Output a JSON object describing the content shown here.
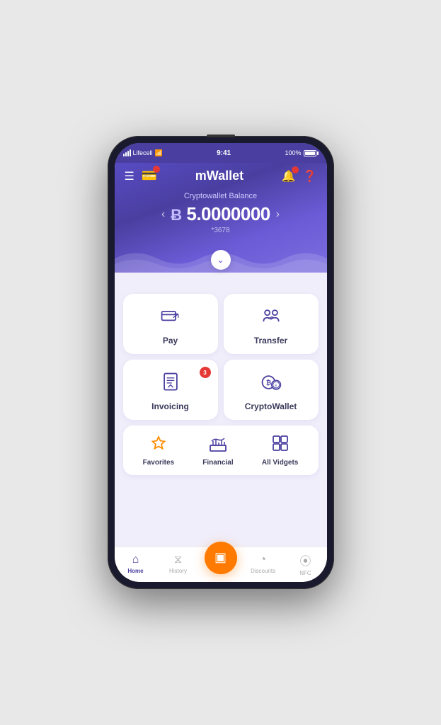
{
  "status_bar": {
    "carrier": "Lifecell",
    "time": "9:41",
    "battery": "100%"
  },
  "header": {
    "app_name": "mWallet",
    "balance_label": "Cryptowallet Balance",
    "currency_symbol": "B",
    "balance": "5.0000000",
    "account_mask": "*3678"
  },
  "actions": [
    {
      "id": "pay",
      "label": "Pay",
      "badge": null
    },
    {
      "id": "transfer",
      "label": "Transfer",
      "badge": null
    },
    {
      "id": "invoicing",
      "label": "Invoicing",
      "badge": "3"
    },
    {
      "id": "cryptowallet",
      "label": "CryptoWallet",
      "badge": null
    }
  ],
  "shortcuts": [
    {
      "id": "favorites",
      "label": "Favorites"
    },
    {
      "id": "financial",
      "label": "Financial"
    },
    {
      "id": "all_widgets",
      "label": "All Vidgets"
    }
  ],
  "bottom_nav": [
    {
      "id": "home",
      "label": "Home",
      "active": true
    },
    {
      "id": "history",
      "label": "History",
      "active": false
    },
    {
      "id": "scan",
      "label": "",
      "is_scan": true
    },
    {
      "id": "discounts",
      "label": "Discounts",
      "active": false
    },
    {
      "id": "nfc",
      "label": "NFC",
      "active": false
    }
  ]
}
